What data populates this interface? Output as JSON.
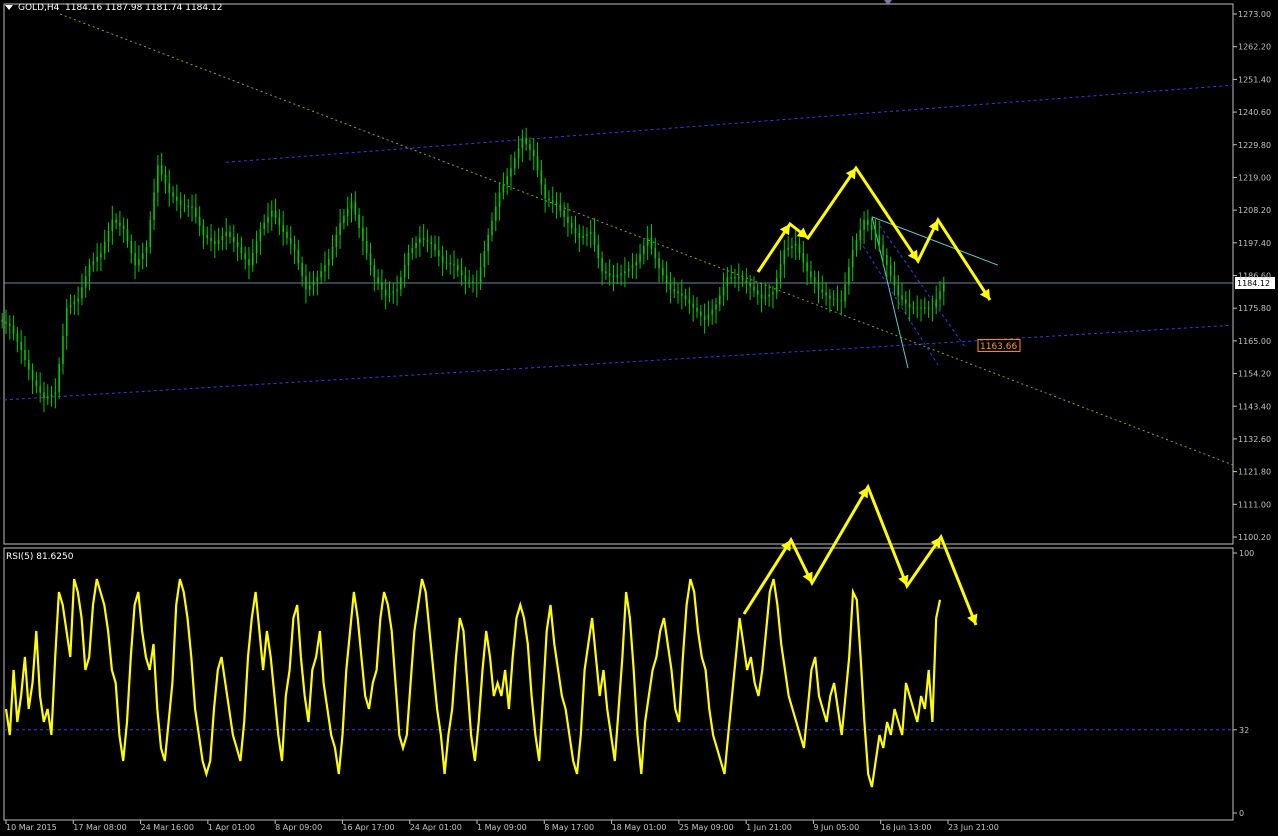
{
  "header": {
    "symbol_label": "GOLD,H4",
    "ohlc_text": "1184.16 1187.98 1181.74 1184.12",
    "rsi_label": "RSI(5) 81.6250"
  },
  "colors": {
    "background": "#000000",
    "candles": "#00c800",
    "axis": "#c0c0c0",
    "channel": "#3a3ad8",
    "trend": "#9a9a20",
    "annotation": "#ffff00",
    "rsi": "#ffff00",
    "cyan": "#5fc8c8",
    "price_line": "#8fb0d0",
    "price_tag_bg": "#ffffff",
    "level_tag": "#ff9a00"
  },
  "chart_data": [
    {
      "type": "candlestick",
      "title": "GOLD,H4",
      "ylim": [
        1100.2,
        1273.0
      ],
      "y_ticks": [
        "1273.00",
        "1262.20",
        "1251.40",
        "1240.60",
        "1229.80",
        "1219.00",
        "1208.20",
        "1197.40",
        "1186.60",
        "1175.80",
        "1165.00",
        "1154.20",
        "1143.40",
        "1132.60",
        "1121.80",
        "1111.00",
        "1100.20"
      ],
      "x_ticks": [
        "10 Mar 2015",
        "17 Mar 08:00",
        "24 Mar 16:00",
        "1 Apr 01:00",
        "8 Apr 09:00",
        "16 Apr 17:00",
        "24 Apr 01:00",
        "1 May 09:00",
        "8 May 17:00",
        "18 May 01:00",
        "25 May 09:00",
        "1 Jun 21:00",
        "9 Jun 05:00",
        "16 Jun 13:00",
        "23 Jun 21:00"
      ],
      "price_close": [
        1170,
        1162,
        1152,
        1146,
        1148,
        1176,
        1179,
        1190,
        1194,
        1205,
        1202,
        1190,
        1196,
        1223,
        1214,
        1210,
        1209,
        1200,
        1197,
        1201,
        1196,
        1190,
        1202,
        1208,
        1201,
        1195,
        1182,
        1186,
        1192,
        1204,
        1211,
        1198,
        1186,
        1180,
        1182,
        1194,
        1199,
        1197,
        1191,
        1190,
        1185,
        1184,
        1200,
        1214,
        1222,
        1232,
        1226,
        1212,
        1210,
        1204,
        1199,
        1201,
        1188,
        1186,
        1188,
        1191,
        1199,
        1189,
        1182,
        1180,
        1176,
        1172,
        1177,
        1186,
        1186,
        1183,
        1179,
        1181,
        1195,
        1197,
        1188,
        1182,
        1179,
        1178,
        1195,
        1205,
        1200,
        1190,
        1180,
        1176,
        1176,
        1176,
        1184
      ],
      "current_price": "1184.12",
      "level_label": "1163.66"
    },
    {
      "type": "line",
      "series": [
        {
          "name": "RSI(5)"
        }
      ],
      "ylim": [
        0,
        100
      ],
      "levels": [
        "100",
        "32",
        "0"
      ],
      "last_value": 81.625,
      "values": [
        40,
        30,
        55,
        35,
        45,
        60,
        40,
        50,
        70,
        45,
        35,
        40,
        30,
        60,
        85,
        80,
        70,
        60,
        90,
        85,
        75,
        55,
        60,
        80,
        90,
        85,
        80,
        70,
        55,
        50,
        30,
        20,
        35,
        60,
        80,
        85,
        70,
        60,
        55,
        65,
        40,
        25,
        20,
        35,
        50,
        80,
        90,
        85,
        75,
        60,
        40,
        30,
        20,
        15,
        20,
        40,
        55,
        60,
        50,
        40,
        30,
        25,
        20,
        35,
        60,
        75,
        85,
        70,
        55,
        70,
        60,
        45,
        30,
        20,
        45,
        55,
        75,
        80,
        60,
        45,
        35,
        55,
        60,
        70,
        50,
        40,
        30,
        25,
        15,
        30,
        55,
        70,
        85,
        75,
        60,
        45,
        40,
        50,
        55,
        75,
        85,
        80,
        70,
        50,
        30,
        25,
        30,
        50,
        70,
        80,
        90,
        85,
        70,
        55,
        40,
        30,
        15,
        30,
        40,
        60,
        75,
        70,
        50,
        30,
        20,
        35,
        55,
        70,
        60,
        45,
        50,
        45,
        55,
        40,
        60,
        75,
        80,
        75,
        65,
        45,
        30,
        20,
        45,
        70,
        80,
        65,
        55,
        45,
        40,
        30,
        20,
        15,
        30,
        55,
        65,
        75,
        60,
        45,
        55,
        40,
        30,
        20,
        40,
        60,
        85,
        75,
        55,
        30,
        15,
        35,
        45,
        55,
        60,
        70,
        75,
        65,
        55,
        40,
        35,
        60,
        80,
        90,
        85,
        70,
        60,
        55,
        40,
        30,
        25,
        20,
        15,
        30,
        45,
        60,
        75,
        65,
        55,
        60,
        50,
        45,
        55,
        70,
        85,
        90,
        80,
        65,
        55,
        45,
        40,
        35,
        30,
        25,
        40,
        55,
        60,
        45,
        40,
        35,
        45,
        50,
        40,
        30,
        45,
        60,
        85,
        82,
        60,
        35,
        15,
        10,
        20,
        30,
        25,
        35,
        30,
        40,
        35,
        30,
        50,
        45,
        40,
        35,
        45,
        40,
        55,
        35,
        75,
        82
      ]
    }
  ],
  "annotations": {
    "main_arrow_path": [
      [
        1166,
        1189
      ],
      [
        1213,
        1204
      ],
      [
        1220,
        1199
      ],
      [
        1240,
        1224
      ],
      [
        1256,
        1193
      ],
      [
        1266,
        1206
      ],
      [
        1279,
        1181
      ]
    ],
    "rsi_arrow_path": [
      [
        0.66,
        68
      ],
      [
        0.83,
        96
      ],
      [
        0.92,
        75
      ],
      [
        1.0,
        98
      ],
      [
        1.08,
        74
      ],
      [
        1.17,
        96
      ],
      [
        1.26,
        64
      ]
    ]
  }
}
